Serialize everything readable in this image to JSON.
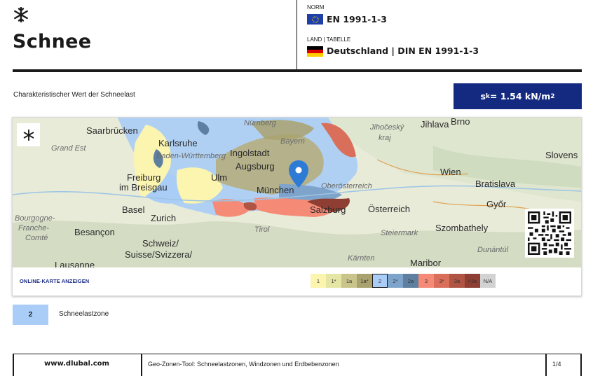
{
  "header": {
    "icon": "snowflake-icon",
    "title": "Schnee",
    "norm_label": "NORM",
    "norm_value": "EN 1991-1-3",
    "land_label": "LAND | TABELLE",
    "land_value": "Deutschland | DIN EN 1991-1-3"
  },
  "characteristic": {
    "label": "Charakteristischer Wert der Schneelast",
    "symbol": "s",
    "symbol_sub": "k",
    "value_text": " = 1.54 kN/m",
    "unit_sup": "2"
  },
  "map": {
    "places": {
      "saarbruecken": "Saarbrücken",
      "grand_est": "Grand Est",
      "karlsruhe": "Karlsruhe",
      "bw": "Baden-Württemberg",
      "nuernberg": "Nürnberg",
      "ingolstadt": "Ingolstadt",
      "bayern": "Bayern",
      "augsburg": "Augsburg",
      "ulm": "Ulm",
      "freiburg": "Freiburg",
      "im_breisgau": "im Breisgau",
      "muenchen": "München",
      "oberoesterreich": "Oberösterreich",
      "salzburg": "Salzburg",
      "basel": "Basel",
      "zurich": "Zurich",
      "bourgogne": "Bourgogne-",
      "franche": "Franche-",
      "comte": "Comté",
      "besancon": "Besançon",
      "schweiz": "Schweiz/",
      "suisse": "Suisse/Svizzera/",
      "lausanne": "Lausanne",
      "tirol": "Tirol",
      "kaernten": "Kärnten",
      "maribor": "Maribor",
      "oesterreich": "Österreich",
      "steiermark": "Steiermark",
      "szombathely": "Szombathely",
      "dunantul": "Dunántúl",
      "jihocesky": "Jihočeský",
      "kraj": "kraj",
      "jihlava": "Jihlava",
      "brno": "Brno",
      "wien": "Wien",
      "bratislava": "Bratislava",
      "gyor": "Győr",
      "slovens": "Slovens"
    },
    "online_link": "ONLINE-KARTE ANZEIGEN",
    "legend": [
      {
        "label": "1",
        "color": "#fbf5b0"
      },
      {
        "label": "1*",
        "color": "#e6e6a4"
      },
      {
        "label": "1a",
        "color": "#c9c48a"
      },
      {
        "label": "1a*",
        "color": "#a9a26e"
      },
      {
        "label": "2",
        "color": "#a9cdf6"
      },
      {
        "label": "2*",
        "color": "#7fa4cc"
      },
      {
        "label": "2a",
        "color": "#5e7f9f"
      },
      {
        "label": "3",
        "color": "#f58a76"
      },
      {
        "label": "3*",
        "color": "#d96e5b"
      },
      {
        "label": "3a",
        "color": "#b05444"
      },
      {
        "label": ">3a",
        "color": "#8e3e32"
      },
      {
        "label": "N/A",
        "color": "#d2d2d2"
      }
    ],
    "active_zone": "2"
  },
  "zone": {
    "value": "2",
    "label": "Schneelastzone"
  },
  "footer": {
    "site": "www.dlubal.com",
    "description": "Geo-Zonen-Tool: Schneelastzonen, Windzonen und Erdbebenzonen",
    "page": "1/4"
  }
}
